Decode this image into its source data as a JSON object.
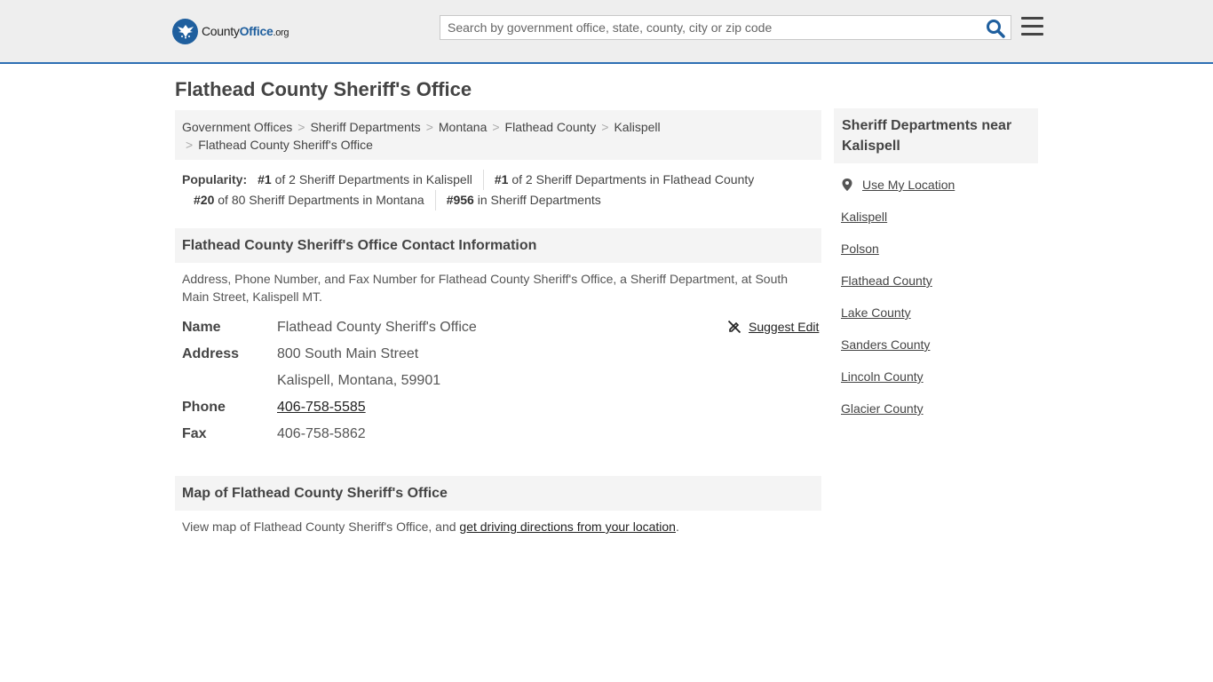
{
  "header": {
    "logo": {
      "county": "County",
      "office": "Office",
      "org": ".org"
    },
    "search_placeholder": "Search by government office, state, county, city or zip code"
  },
  "page_title": "Flathead County Sheriff's Office",
  "breadcrumb": [
    "Government Offices",
    "Sheriff Departments",
    "Montana",
    "Flathead County",
    "Kalispell",
    "Flathead County Sheriff's Office"
  ],
  "popularity": {
    "label": "Popularity:",
    "items": [
      {
        "rank": "#1",
        "text": " of 2 Sheriff Departments in Kalispell"
      },
      {
        "rank": "#1",
        "text": " of 2 Sheriff Departments in Flathead County"
      },
      {
        "rank": "#20",
        "text": " of 80 Sheriff Departments in Montana"
      },
      {
        "rank": "#956",
        "text": " in Sheriff Departments"
      }
    ]
  },
  "contact": {
    "heading": "Flathead County Sheriff's Office Contact Information",
    "description": "Address, Phone Number, and Fax Number for Flathead County Sheriff's Office, a Sheriff Department, at South Main Street, Kalispell MT.",
    "suggest_edit": "Suggest Edit",
    "name_label": "Name",
    "name_value": "Flathead County Sheriff's Office",
    "address_label": "Address",
    "address_line1": "800 South Main Street",
    "address_line2": "Kalispell, Montana, 59901",
    "phone_label": "Phone",
    "phone_value": "406-758-5585",
    "fax_label": "Fax",
    "fax_value": "406-758-5862"
  },
  "map": {
    "heading": "Map of Flathead County Sheriff's Office",
    "text_before": "View map of Flathead County Sheriff's Office, and ",
    "link": "get driving directions from your location",
    "text_after": "."
  },
  "sidebar": {
    "heading": "Sheriff Departments near Kalispell",
    "use_location": "Use My Location",
    "links": [
      "Kalispell",
      "Polson",
      "Flathead County",
      "Lake County",
      "Sanders County",
      "Lincoln County",
      "Glacier County"
    ]
  }
}
